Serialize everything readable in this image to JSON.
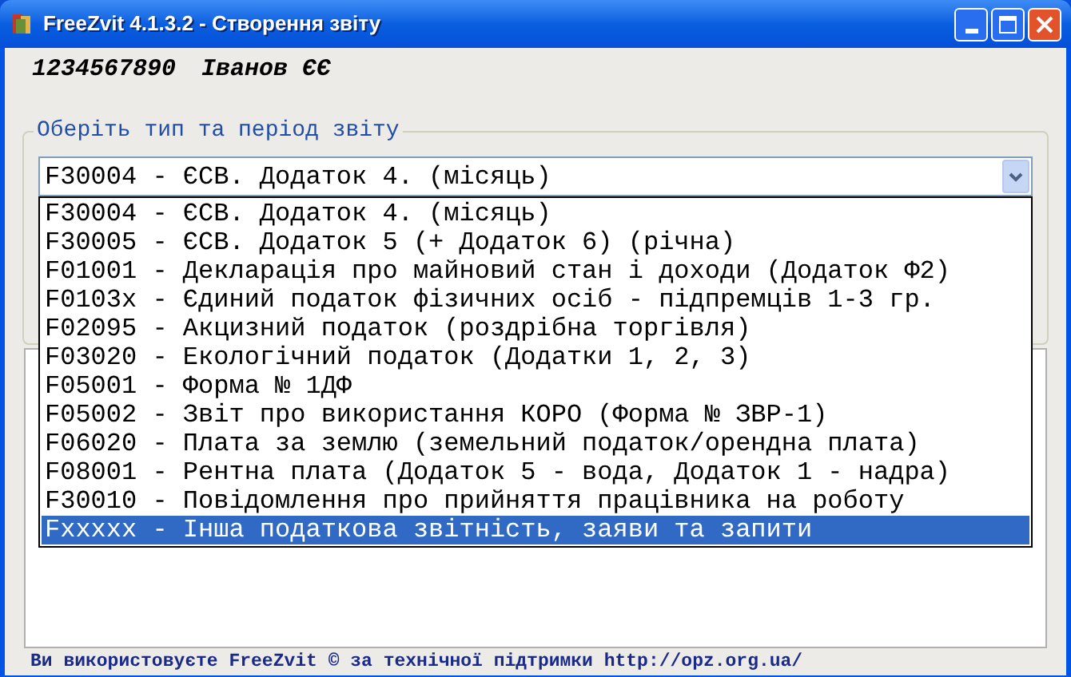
{
  "window": {
    "title": "FreeZvit 4.1.3.2 - Створення звіту"
  },
  "taxpayer": {
    "code": "1234567890",
    "name": "Іванов ЄЄ"
  },
  "report_group": {
    "legend": "Оберіть тип та період звіту",
    "combo_value": "F30004 - ЄСВ. Додаток 4. (місяць)",
    "options": [
      {
        "label": "F30004 - ЄСВ. Додаток 4. (місяць)",
        "selected": false
      },
      {
        "label": "F30005 - ЄСВ. Додаток 5 (+ Додаток 6) (річна)",
        "selected": false
      },
      {
        "label": "F01001 - Декларація про майновий стан і доходи (Додаток Ф2)",
        "selected": false
      },
      {
        "label": "F0103x - Єдиний податок фізичних осіб - підпремців 1-3 гр.",
        "selected": false
      },
      {
        "label": "F02095 - Акцизний податок (роздрібна торгівля)",
        "selected": false
      },
      {
        "label": "F03020 - Екологічний податок (Додатки 1, 2, 3)",
        "selected": false
      },
      {
        "label": "F05001 - Форма № 1ДФ",
        "selected": false
      },
      {
        "label": "F05002 - Звіт про використання КОРО (Форма № ЗВР-1)",
        "selected": false
      },
      {
        "label": "F06020 - Плата за землю (земельний податок/орендна плата)",
        "selected": false
      },
      {
        "label": "F08001 - Рентна плата (Додаток 5 - вода, Додаток 1 - надра)",
        "selected": false
      },
      {
        "label": "F30010 - Повідомлення про прийняття працівника на роботу",
        "selected": false
      },
      {
        "label": "Fxxxxx - Інша податкова звітність, заяви та запити",
        "selected": true
      }
    ]
  },
  "status_bar": {
    "text": "Ви використовуєте FreeZvit © за технічної підтримки http://opz.org.ua/"
  }
}
